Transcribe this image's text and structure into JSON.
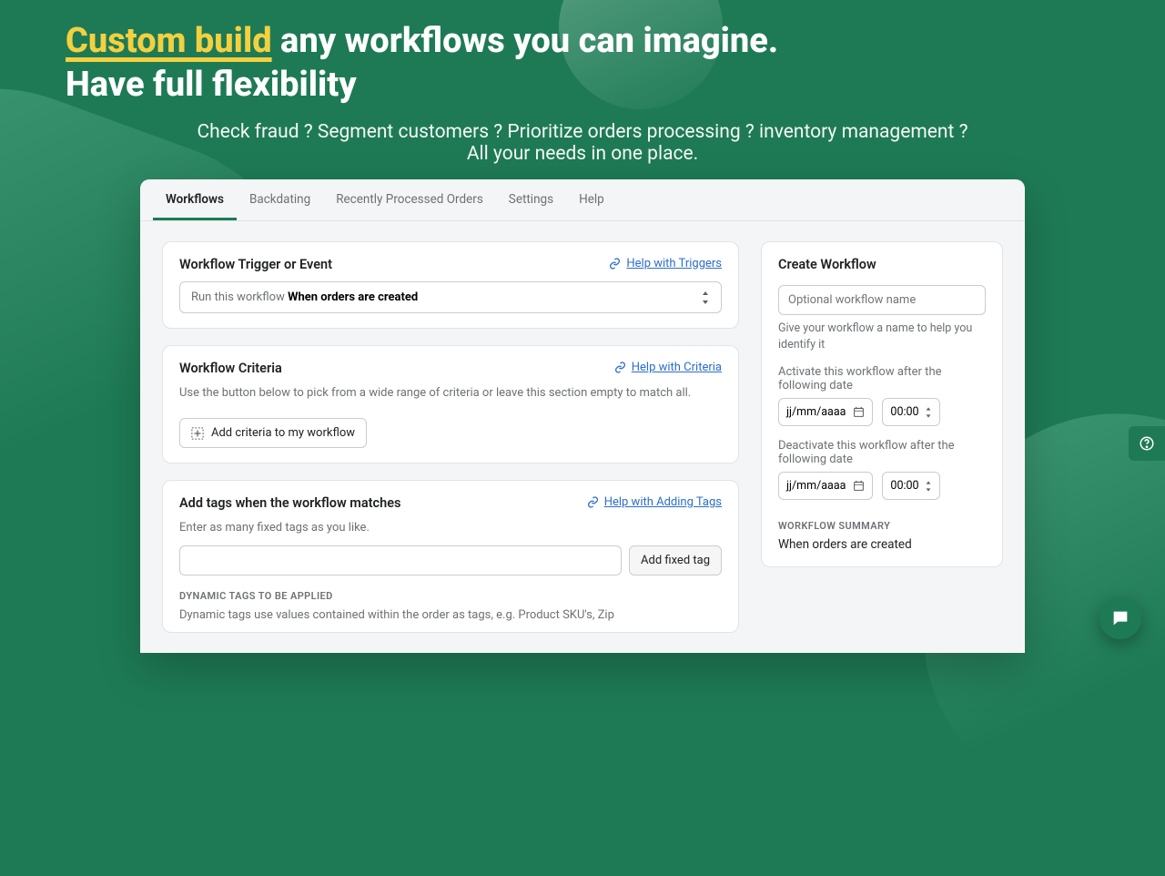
{
  "hero": {
    "highlight": "Custom build",
    "title_rest": " any workflows you can imagine.",
    "title_line2": "Have full flexibility",
    "sub1": "Check fraud ? Segment customers ?  Prioritize orders processing ? inventory management ?",
    "sub2": "All your needs in one place."
  },
  "tabs": [
    "Workflows",
    "Backdating",
    "Recently Processed Orders",
    "Settings",
    "Help"
  ],
  "trigger": {
    "title": "Workflow Trigger or Event",
    "help": "Help with Triggers",
    "select_pre": "Run this workflow ",
    "select_val": "When orders are created"
  },
  "criteria": {
    "title": "Workflow Criteria",
    "help": "Help with Criteria",
    "desc": "Use the button below to pick from a wide range of criteria or leave this section empty to match all.",
    "btn": "Add criteria to my workflow"
  },
  "tags": {
    "title": "Add tags when the workflow matches",
    "help": "Help with Adding Tags",
    "desc": "Enter as many fixed tags as you like.",
    "btn": "Add fixed tag",
    "dyn_hdr": "DYNAMIC TAGS TO BE APPLIED",
    "dyn_desc": "Dynamic tags use values contained within the order as tags, e.g. Product SKU's, Zip"
  },
  "create": {
    "title": "Create Workflow",
    "name_ph": "Optional workflow name",
    "name_help": "Give your workflow a name to help you identify it",
    "activate_label": "Activate this workflow after the following date",
    "date_ph": "jj/mm/aaaa",
    "time_ph": "00:00",
    "deactivate_label": "Deactivate this workflow after the following date",
    "summary_hdr": "WORKFLOW SUMMARY",
    "summary_txt": "When orders are created"
  }
}
